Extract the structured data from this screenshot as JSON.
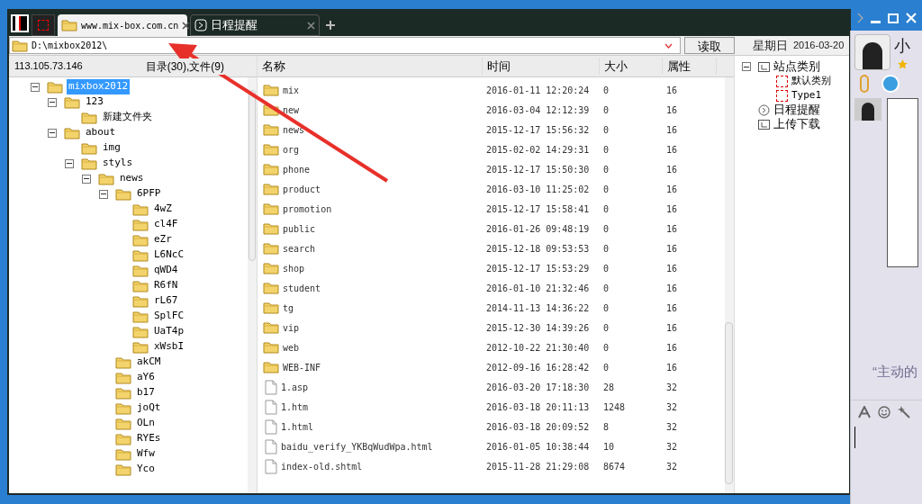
{
  "tabs": [
    {
      "label": "www.mix-box.com.cn",
      "kind": "folder",
      "selected": true
    },
    {
      "label": "日程提醒",
      "kind": "schedule",
      "selected": false
    }
  ],
  "address": {
    "value": "D:\\mixbox2012\\",
    "button": "读取"
  },
  "date": {
    "weekday": "星期日",
    "value": "2016-03-20"
  },
  "server": "113.105.73.146",
  "summary": "目录(30),文件(9)",
  "tree": [
    {
      "label": "mixbox2012",
      "selected": true,
      "expanded": true,
      "children": [
        {
          "label": "123",
          "selected": false,
          "expanded": true,
          "children": [
            {
              "label": "新建文件夹",
              "selected": false
            }
          ]
        },
        {
          "label": "about",
          "selected": false,
          "expanded": true,
          "children": [
            {
              "label": "img",
              "selected": false
            },
            {
              "label": "styls",
              "selected": false,
              "expanded": true,
              "children": [
                {
                  "label": "news",
                  "selected": false,
                  "expanded": true,
                  "children": [
                    {
                      "label": "6PFP",
                      "selected": false,
                      "expanded": true,
                      "children": [
                        {
                          "label": "4wZ",
                          "selected": false
                        },
                        {
                          "label": "cl4F",
                          "selected": false
                        },
                        {
                          "label": "eZr",
                          "selected": false
                        },
                        {
                          "label": "L6NcC",
                          "selected": false
                        },
                        {
                          "label": "qWD4",
                          "selected": false
                        },
                        {
                          "label": "R6fN",
                          "selected": false
                        },
                        {
                          "label": "rL67",
                          "selected": false
                        },
                        {
                          "label": "SplFC",
                          "selected": false
                        },
                        {
                          "label": "UaT4p",
                          "selected": false
                        },
                        {
                          "label": "xWsbI",
                          "selected": false
                        }
                      ]
                    },
                    {
                      "label": "akCM",
                      "selected": false
                    },
                    {
                      "label": "aY6",
                      "selected": false
                    },
                    {
                      "label": "b17",
                      "selected": false
                    },
                    {
                      "label": "joQt",
                      "selected": false
                    },
                    {
                      "label": "OLn",
                      "selected": false
                    },
                    {
                      "label": "RYEs",
                      "selected": false
                    },
                    {
                      "label": "Wfw",
                      "selected": false
                    },
                    {
                      "label": "Yco",
                      "selected": false
                    }
                  ]
                }
              ]
            }
          ]
        }
      ]
    }
  ],
  "file_columns": [
    "名称",
    "时间",
    "大小",
    "属性"
  ],
  "files": [
    {
      "kind": "folder",
      "name": "mix",
      "time": "2016-01-11 12:20:24",
      "size": "0",
      "attr": "16"
    },
    {
      "kind": "folder",
      "name": "new",
      "time": "2016-03-04 12:12:39",
      "size": "0",
      "attr": "16"
    },
    {
      "kind": "folder",
      "name": "news",
      "time": "2015-12-17 15:56:32",
      "size": "0",
      "attr": "16"
    },
    {
      "kind": "folder",
      "name": "org",
      "time": "2015-02-02 14:29:31",
      "size": "0",
      "attr": "16"
    },
    {
      "kind": "folder",
      "name": "phone",
      "time": "2015-12-17 15:50:30",
      "size": "0",
      "attr": "16"
    },
    {
      "kind": "folder",
      "name": "product",
      "time": "2016-03-10 11:25:02",
      "size": "0",
      "attr": "16"
    },
    {
      "kind": "folder",
      "name": "promotion",
      "time": "2015-12-17 15:58:41",
      "size": "0",
      "attr": "16"
    },
    {
      "kind": "folder",
      "name": "public",
      "time": "2016-01-26 09:48:19",
      "size": "0",
      "attr": "16"
    },
    {
      "kind": "folder",
      "name": "search",
      "time": "2015-12-18 09:53:53",
      "size": "0",
      "attr": "16"
    },
    {
      "kind": "folder",
      "name": "shop",
      "time": "2015-12-17 15:53:29",
      "size": "0",
      "attr": "16"
    },
    {
      "kind": "folder",
      "name": "student",
      "time": "2016-01-10 21:32:46",
      "size": "0",
      "attr": "16"
    },
    {
      "kind": "folder",
      "name": "tg",
      "time": "2014-11-13 14:36:22",
      "size": "0",
      "attr": "16"
    },
    {
      "kind": "folder",
      "name": "vip",
      "time": "2015-12-30 14:39:26",
      "size": "0",
      "attr": "16"
    },
    {
      "kind": "folder",
      "name": "web",
      "time": "2012-10-22 21:30:40",
      "size": "0",
      "attr": "16"
    },
    {
      "kind": "folder",
      "name": "WEB-INF",
      "time": "2012-09-16 16:28:42",
      "size": "0",
      "attr": "16"
    },
    {
      "kind": "file",
      "name": "1.asp",
      "time": "2016-03-20 17:18:30",
      "size": "28",
      "attr": "32"
    },
    {
      "kind": "file",
      "name": "1.htm",
      "time": "2016-03-18 20:11:13",
      "size": "1248",
      "attr": "32"
    },
    {
      "kind": "file",
      "name": "1.html",
      "time": "2016-03-18 20:09:52",
      "size": "8",
      "attr": "32"
    },
    {
      "kind": "file",
      "name": "baidu_verify_YKBqWudWpa.html",
      "time": "2016-01-05 10:38:44",
      "size": "10",
      "attr": "32"
    },
    {
      "kind": "file",
      "name": "index-old.shtml",
      "time": "2015-11-28 21:29:08",
      "size": "8674",
      "attr": "32"
    }
  ],
  "site_tree": [
    {
      "label": "站点类别",
      "kind": "category",
      "expanded": true,
      "children": [
        {
          "label": "默认类别",
          "kind": "type"
        },
        {
          "label": "Type1",
          "kind": "type"
        }
      ]
    },
    {
      "label": "日程提醒",
      "kind": "schedule"
    },
    {
      "label": "上传下载",
      "kind": "transfer"
    }
  ],
  "chat": {
    "name": "小",
    "quote": "“主动的"
  }
}
